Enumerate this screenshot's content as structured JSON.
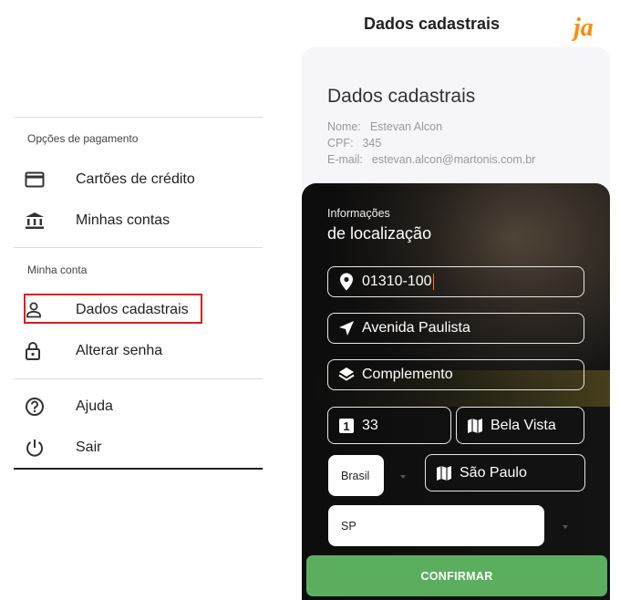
{
  "menu": {
    "section_payment": "Opções de pagamento",
    "cards": "Cartões de crédito",
    "accounts": "Minhas contas",
    "section_account": "Minha conta",
    "profile": "Dados cadastrais",
    "change_password": "Alterar senha",
    "help": "Ajuda",
    "logout": "Sair"
  },
  "header": {
    "title": "Dados cadastrais",
    "logo_text": "ja"
  },
  "profile_card": {
    "title": "Dados cadastrais",
    "name_label": "Nome:",
    "name_value": "Estevan Alcon",
    "cpf_label": "CPF:",
    "cpf_value": "345",
    "email_label": "E-mail:",
    "email_value": "estevan.alcon@martonis.com.br"
  },
  "location": {
    "subtitle": "Informações",
    "title": "de localização",
    "cep": "01310-100",
    "street": "Avenida Paulista",
    "complement": "Complemento",
    "number": "33",
    "neighborhood": "Bela Vista",
    "country": "Brasil",
    "city": "São Paulo",
    "state": "SP"
  },
  "confirm_label": "CONFIRMAR",
  "colors": {
    "accent": "#5cae5f",
    "highlight": "#e01919",
    "logo": "#ff8a00"
  }
}
